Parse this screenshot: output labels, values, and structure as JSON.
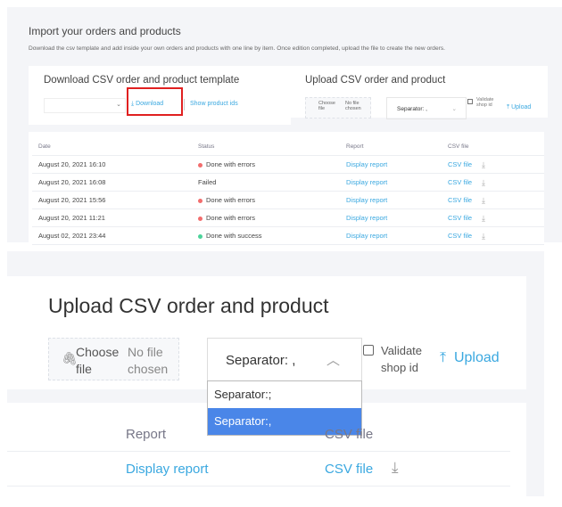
{
  "page": {
    "title": "Import your orders and products",
    "description": "Download the csv template and add inside your own orders and products with one line by item. Once edition completed, upload the file to create the new orders."
  },
  "download": {
    "title": "Download CSV order and product template",
    "select_value": "",
    "download_label": "Download",
    "show_ids_label": "Show product ids"
  },
  "upload": {
    "title": "Upload CSV order and product",
    "choose_file": "Choose file",
    "no_file": "No file chosen",
    "separator_label": "Separator: ,",
    "validate_label": "Validate shop id",
    "upload_label": "Upload",
    "options": [
      "Separator:;",
      "Separator:,"
    ],
    "selected_option": "Separator:,"
  },
  "table": {
    "headers": [
      "Date",
      "Status",
      "Report",
      "CSV file"
    ],
    "rows": [
      {
        "date": "August 20, 2021 16:10",
        "status": "Done with errors",
        "status_color": "#f26d6d",
        "report": "Display report",
        "csv": "CSV file"
      },
      {
        "date": "August 20, 2021 16:08",
        "status": "Failed",
        "status_color": "",
        "report": "Display report",
        "csv": "CSV file"
      },
      {
        "date": "August 20, 2021 15:56",
        "status": "Done with errors",
        "status_color": "#f26d6d",
        "report": "Display report",
        "csv": "CSV file"
      },
      {
        "date": "August 20, 2021 11:21",
        "status": "Done with errors",
        "status_color": "#f26d6d",
        "report": "Display report",
        "csv": "CSV file"
      },
      {
        "date": "August 02, 2021 23:44",
        "status": "Done with success",
        "status_color": "#4cd39a",
        "report": "Display report",
        "csv": "CSV file"
      }
    ]
  },
  "colors": {
    "accent": "#3aa8e0",
    "highlight": "#e02020",
    "selected": "#4a86e8"
  }
}
